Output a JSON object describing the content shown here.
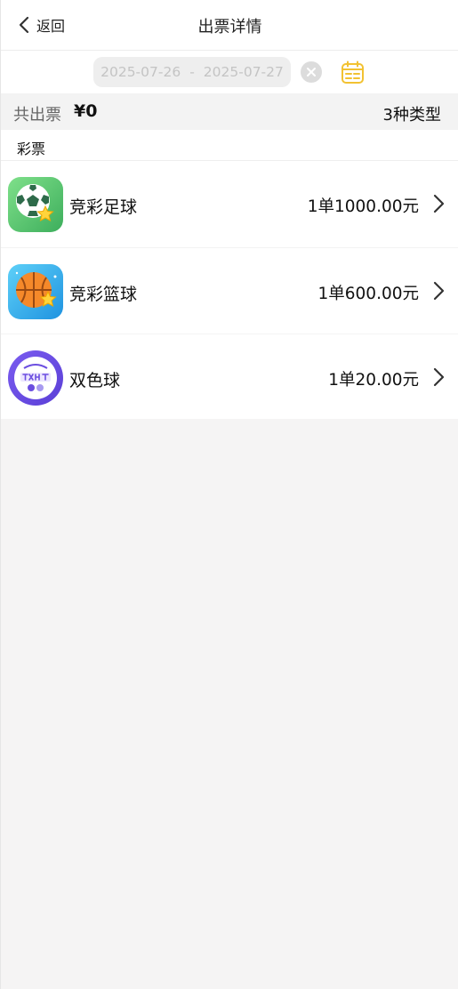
{
  "header": {
    "back_label": "返回",
    "title": "出票详情"
  },
  "date_filter": {
    "start": "2025-07-26",
    "separator": "-",
    "end": "2025-07-27",
    "clear_icon": "clear-icon",
    "calendar_icon": "calendar-icon"
  },
  "summary": {
    "label": "共出票",
    "amount": "¥0",
    "types": "3种类型"
  },
  "section": {
    "label": "彩票"
  },
  "items": [
    {
      "name": "竞彩足球",
      "value": "1单1000.00元",
      "icon": "soccer-ball-icon"
    },
    {
      "name": "竞彩篮球",
      "value": "1单600.00元",
      "icon": "basketball-icon"
    },
    {
      "name": "双色球",
      "value": "1单20.00元",
      "icon": "double-color-ball-icon"
    }
  ],
  "colors": {
    "accent_yellow": "#f2c232",
    "soccer_green": "#5cc873",
    "basketball_blue": "#2ea8e8",
    "ssq_purple": "#6b4ee0"
  }
}
